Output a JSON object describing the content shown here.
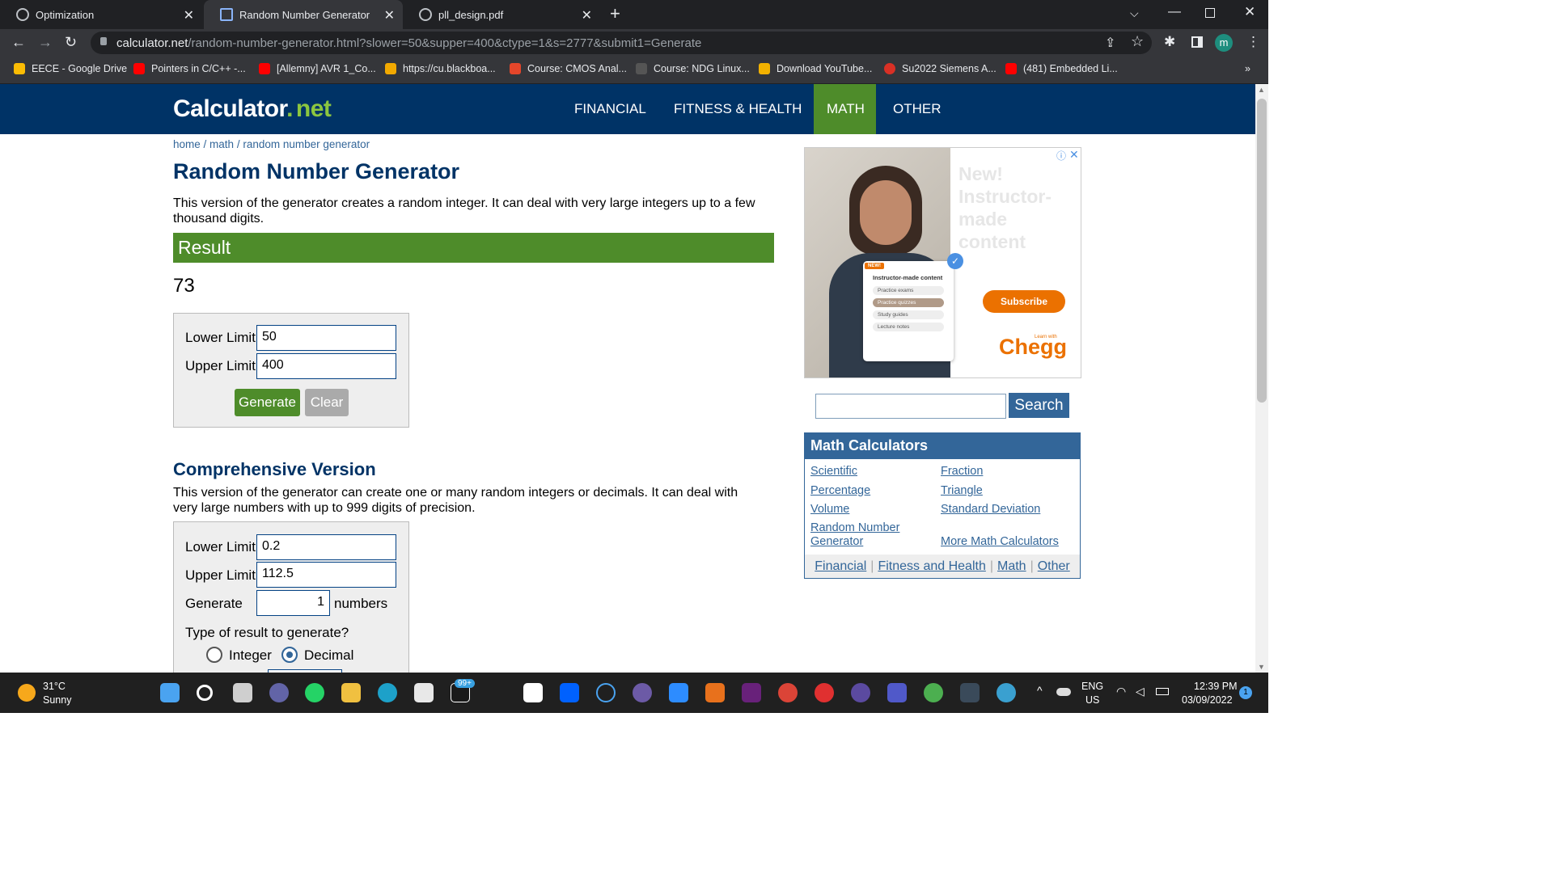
{
  "browser": {
    "tabs": [
      {
        "label": "Optimization",
        "active": false
      },
      {
        "label": "Random Number Generator",
        "active": true
      },
      {
        "label": "pll_design.pdf",
        "active": false
      }
    ],
    "new_tab": "+",
    "url_host": "calculator.net",
    "url_path": "/random-number-generator.html?slower=50&supper=400&ctype=1&s=2777&submit1=Generate",
    "profile_initial": "m",
    "bookmarks": [
      {
        "label": "EECE - Google Drive",
        "color": "#fbbc04"
      },
      {
        "label": "Pointers in C/C++ -...",
        "color": "#ff0000"
      },
      {
        "label": "[Allemny] AVR 1_Co...",
        "color": "#ff0000"
      },
      {
        "label": "https://cu.blackboa...",
        "color": "#f2a900"
      },
      {
        "label": "Course: CMOS Anal...",
        "color": "#e5462a"
      },
      {
        "label": "Course: NDG Linux...",
        "color": "#555555"
      },
      {
        "label": "Download YouTube...",
        "color": "#f2b100"
      },
      {
        "label": "Su2022 Siemens A...",
        "color": "#d93025"
      },
      {
        "label": "(481) Embedded Li...",
        "color": "#ff0000"
      }
    ],
    "more_bookmarks": "»"
  },
  "site": {
    "logo_main": "Calculator",
    "logo_dot": ".",
    "logo_net": "net",
    "nav": [
      "FINANCIAL",
      "FITNESS & HEALTH",
      "MATH",
      "OTHER"
    ],
    "active_nav": "MATH",
    "breadcrumb": {
      "home": "home",
      "sep": " / ",
      "math": "math",
      "current": "random number generator"
    }
  },
  "main": {
    "title": "Random Number Generator",
    "intro": "This version of the generator creates a random integer. It can deal with very large integers up to a few thousand digits.",
    "result_heading": "Result",
    "result_value": "73",
    "simple_form": {
      "lower_label": "Lower Limit",
      "lower_value": "50",
      "upper_label": "Upper Limit",
      "upper_value": "400",
      "generate_label": "Generate",
      "clear_label": "Clear"
    },
    "comprehensive": {
      "title": "Comprehensive Version",
      "intro": "This version of the generator can create one or many random integers or decimals. It can deal with very large numbers with up to 999 digits of precision.",
      "lower_label": "Lower Limit",
      "lower_value": "0.2",
      "upper_label": "Upper Limit",
      "upper_value": "112.5",
      "generate_label": "Generate",
      "count_value": "1",
      "numbers_label": "numbers",
      "type_question": "Type of result to generate?",
      "type_integer": "Integer",
      "type_decimal": "Decimal",
      "type_selected": "Decimal"
    }
  },
  "sidebar": {
    "ad": {
      "headline": [
        "New!",
        "Instructor-",
        "made",
        "content"
      ],
      "badge": "NEW!",
      "card_title": "Instructor-made content",
      "card_items": [
        "Practice exams",
        "Practice quizzes",
        "Study guides",
        "Lecture notes"
      ],
      "subscribe": "Subscribe",
      "learn_with": "Learn with",
      "brand": "Chegg"
    },
    "search_button": "Search",
    "math_calculators": {
      "heading": "Math Calculators",
      "left": [
        "Scientific",
        "Percentage",
        "Volume",
        "Random Number Generator"
      ],
      "right": [
        "Fraction",
        "Triangle",
        "Standard Deviation",
        "More Math Calculators"
      ],
      "footer": [
        "Financial",
        "Fitness and Health",
        "Math",
        "Other"
      ]
    }
  },
  "taskbar": {
    "temp": "31°C",
    "weather": "Sunny",
    "badge": "99+",
    "lang": "ENG",
    "region": "US",
    "time": "12:39 PM",
    "date": "03/09/2022",
    "notif": "1"
  }
}
